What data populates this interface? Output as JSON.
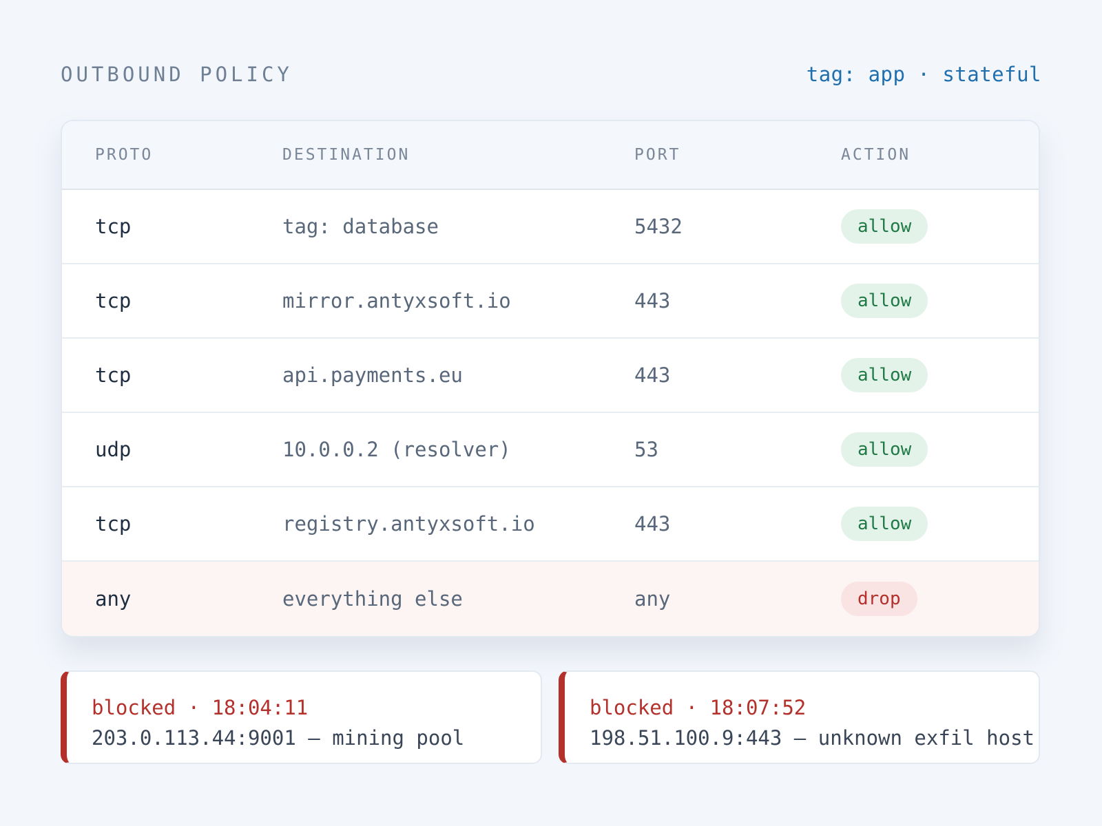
{
  "header": {
    "title": "OUTBOUND POLICY",
    "meta": "tag: app · stateful"
  },
  "table": {
    "columns": [
      "PROTO",
      "DESTINATION",
      "PORT",
      "ACTION"
    ],
    "rows": [
      {
        "proto": "tcp",
        "destination": "tag: database",
        "port": "5432",
        "action": "allow"
      },
      {
        "proto": "tcp",
        "destination": "mirror.antyxsoft.io",
        "port": "443",
        "action": "allow"
      },
      {
        "proto": "tcp",
        "destination": "api.payments.eu",
        "port": "443",
        "action": "allow"
      },
      {
        "proto": "udp",
        "destination": "10.0.0.2 (resolver)",
        "port": "53",
        "action": "allow"
      },
      {
        "proto": "tcp",
        "destination": "registry.antyxsoft.io",
        "port": "443",
        "action": "allow"
      },
      {
        "proto": "any",
        "destination": "everything else",
        "port": "any",
        "action": "drop"
      }
    ]
  },
  "events": [
    {
      "status": "blocked · 18:04:11",
      "detail": "203.0.113.44:9001 — mining pool"
    },
    {
      "status": "blocked · 18:07:52",
      "detail": "198.51.100.9:443 — unknown exfil host"
    }
  ],
  "colors": {
    "allow": "#1f7a45",
    "drop": "#b3302b",
    "accent": "#1f6fae"
  }
}
